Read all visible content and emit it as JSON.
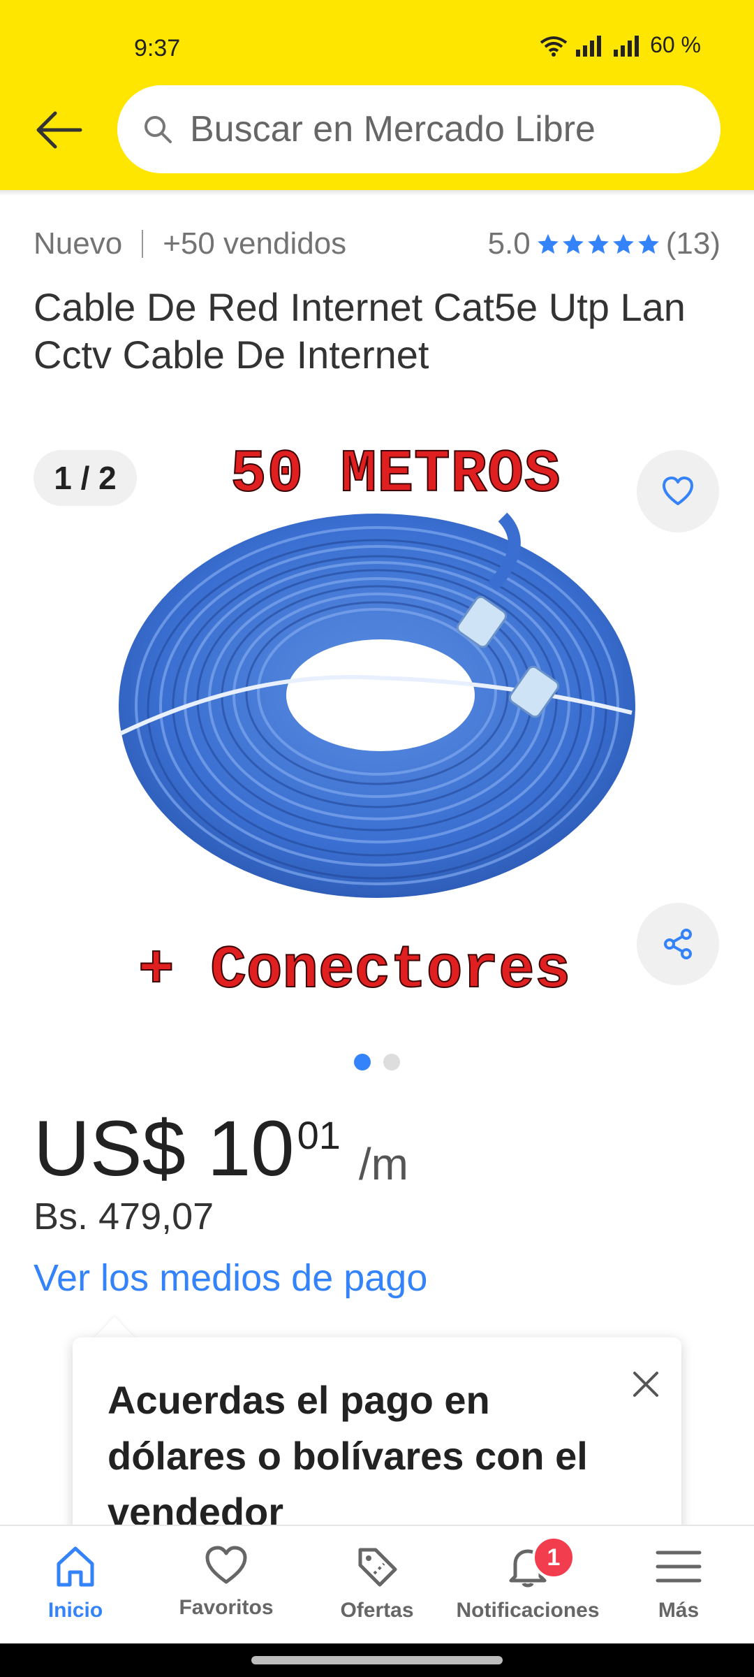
{
  "status": {
    "time": "9:37",
    "battery": "60 %"
  },
  "search": {
    "placeholder": "Buscar en Mercado Libre"
  },
  "product": {
    "condition": "Nuevo",
    "sold": "+50 vendidos",
    "rating": "5.0",
    "stars": 5,
    "reviews": "(13)",
    "title": "Cable De Red Internet Cat5e Utp Lan Cctv Cable De Internet"
  },
  "gallery": {
    "counter": "1 / 2",
    "image_text_top": "50 METROS",
    "image_text_bottom": "+ Conectores",
    "total_images": 2,
    "current_image": 1
  },
  "price": {
    "currency_amount": "US$ 10",
    "cents": "01",
    "unit": "/m",
    "local": "Bs. 479,07",
    "payments_link": "Ver los medios de pago"
  },
  "tooltip": {
    "text": "Acuerdas el pago en dólares o bolívares con el vendedor"
  },
  "nav": {
    "items": [
      {
        "label": "Inicio",
        "icon": "home-icon",
        "active": true
      },
      {
        "label": "Favoritos",
        "icon": "heart-icon"
      },
      {
        "label": "Ofertas",
        "icon": "tag-icon"
      },
      {
        "label": "Notificaciones",
        "icon": "bell-icon",
        "badge": "1"
      },
      {
        "label": "Más",
        "icon": "menu-icon"
      }
    ]
  },
  "colors": {
    "header": "#ffe600",
    "accent": "#3483fa",
    "badge": "#f23d4f",
    "image_text": "#e02020"
  }
}
